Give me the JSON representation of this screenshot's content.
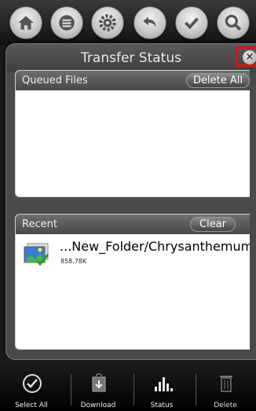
{
  "toolbar": {
    "buttons": [
      {
        "icon": "home-icon"
      },
      {
        "icon": "menu-list-icon"
      },
      {
        "icon": "settings-gear-icon"
      },
      {
        "icon": "back-arrow-icon"
      },
      {
        "icon": "checkmark-icon"
      },
      {
        "icon": "search-icon"
      }
    ]
  },
  "dialog": {
    "title": "Transfer Status",
    "close_icon": "close-icon",
    "queued": {
      "header": "Queued Files",
      "delete_all_label": "Delete All"
    },
    "recent": {
      "header": "Recent",
      "clear_label": "Clear",
      "items": [
        {
          "name": "...New_Folder/Chrysanthemum.jpg",
          "size": "858.78K",
          "icon": "image-file-icon"
        }
      ]
    }
  },
  "bottom_bar": {
    "select_all": "Select All",
    "download": "Download",
    "status": "Status",
    "delete": "Delete"
  },
  "colors": {
    "highlight_border": "#e01010",
    "dialog_bg": "#4a4a4a",
    "list_bg": "#ffffff"
  }
}
